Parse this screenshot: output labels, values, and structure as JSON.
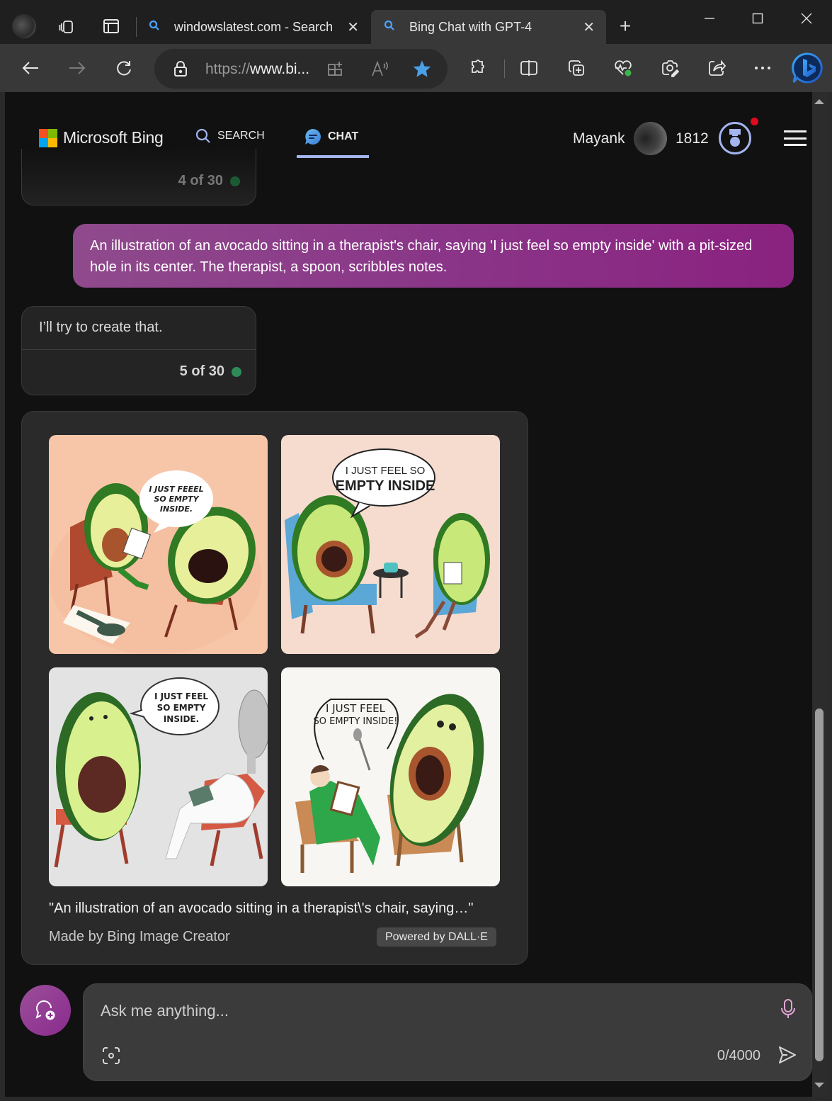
{
  "browser": {
    "tabs": [
      {
        "title": "windowslatest.com - Search",
        "active": false
      },
      {
        "title": "Bing Chat with GPT-4",
        "active": true
      }
    ],
    "address": {
      "scheme": "https://",
      "host_truncated": "www.bi..."
    },
    "favorite_active": true,
    "accent_color": "#4ba3ff"
  },
  "header": {
    "brand": "Microsoft Bing",
    "nav": [
      {
        "label": "SEARCH",
        "active": false
      },
      {
        "label": "CHAT",
        "active": true
      }
    ],
    "user_name": "Mayank",
    "rewards_points": "1812",
    "has_notification": true
  },
  "conversation": {
    "previous_counter": "4 of 30",
    "user_message": "An illustration of an avocado sitting in a therapist's chair, saying 'I just feel so empty inside' with a pit-sized hole in its center. The therapist, a spoon, scribbles notes.",
    "reply_text": "I’ll try to create that.",
    "reply_counter": "5 of 30",
    "status_color": "#2e8b57",
    "image_result": {
      "images": [
        {
          "alt": "Avocado therapist with clipboard and avocado patient on red chairs, spoon on napkin",
          "speech": [
            "I JUST FEEEL",
            "SO EMPTY",
            "INSIDE."
          ],
          "bg": "#f7c9ad"
        },
        {
          "alt": "Avocado on blue chair talking to avocado therapist with notepad, small table with teapot",
          "speech": [
            "I JUST FEEL SO",
            "EMPTY INSIDE"
          ],
          "bg": "#f6dccf"
        },
        {
          "alt": "Avocado on red chair talking to a spoon-headed therapist in white",
          "speech": [
            "I JUST FEEL",
            "SO EMPTY",
            "INSIDE."
          ],
          "bg": "#e2e2e2"
        },
        {
          "alt": "Man in green suit with clipboard listening to large avocado on chair",
          "speech": [
            "I JUST FEEL",
            "SO EMPTY INSIDE!"
          ],
          "bg": "#f6f5f1"
        }
      ],
      "caption": "\"An illustration of an avocado sitting in a therapist\\'s chair, saying…\"",
      "credit": "Made by Bing Image Creator",
      "badge": "Powered by DALL·E"
    }
  },
  "composer": {
    "placeholder": "Ask me anything...",
    "value": "",
    "char_count": "0/4000"
  }
}
